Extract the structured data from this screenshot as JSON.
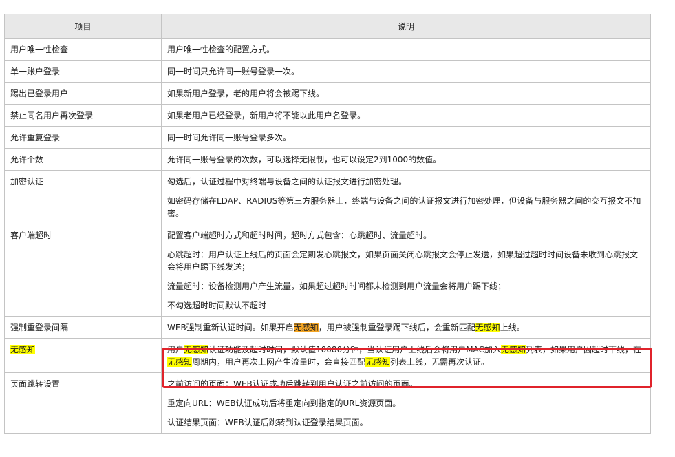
{
  "header": {
    "col_item": "项目",
    "col_desc": "说明"
  },
  "rows": [
    {
      "item": "用户唯一性检查",
      "desc": [
        "用户唯一性检查的配置方式。"
      ]
    },
    {
      "item": "单一账户登录",
      "desc": [
        "同一时间只允许同一账号登录一次。"
      ]
    },
    {
      "item": "踢出已登录用户",
      "desc": [
        "如果新用户登录，老的用户将会被踢下线。"
      ]
    },
    {
      "item": "禁止同名用户再次登录",
      "desc": [
        "如果老用户已经登录，新用户将不能以此用户名登录。"
      ]
    },
    {
      "item": "允许重复登录",
      "desc": [
        "同一时间允许同一账号登录多次。"
      ]
    },
    {
      "item": "允许个数",
      "desc": [
        "允许同一账号登录的次数，可以选择无限制，也可以设定2到1000的数值。"
      ]
    },
    {
      "item": "加密认证",
      "desc": [
        "勾选后，认证过程中对终端与设备之间的认证报文进行加密处理。",
        "如密码存储在LDAP、RADIUS等第三方服务器上，终端与设备之间的认证报文进行加密处理，但设备与服务器之间的交互报文不加密。"
      ]
    },
    {
      "item": "客户端超时",
      "desc": [
        "配置客户端超时方式和超时时间，超时方式包含：心跳超时、流量超时。",
        "心跳超时：用户认证上线后的页面会定期发心跳报文，如果页面关闭心跳报文会停止发送，如果超过超时时间设备未收到心跳报文会将用户踢下线发送；",
        "流量超时：设备检测用户产生流量，如果超过超时时间都未检测到用户流量会将用户踢下线；",
        "不勾选超时时间默认不超时"
      ]
    },
    {
      "item": "强制重登录间隔",
      "desc_parts": [
        "WEB强制重新认证时间。如果开启",
        "无感知",
        "，用户被强制重登录踢下线后，会重新匹配",
        "无感知",
        "上线。"
      ]
    },
    {
      "item": "无感知",
      "desc_parts": [
        "用户",
        "无感知",
        "认证功能及超时时间，默认值10080分钟，当认证用户上线后会将用户MAC加入",
        "无感知",
        "列表，如果用户因超时下线，在",
        "无感知",
        "周期内，用户再次上网产生流量时，会直接匹配",
        "无感知",
        "列表上线，无需再次认证。"
      ]
    },
    {
      "item": "页面跳转设置",
      "desc": [
        "之前访问的页面：WEB认证成功后跳转到用户认证之前访问的页面。",
        "重定向URL：WEB认证成功后将重定向到指定的URL资源页面。",
        "认证结果页面：WEB认证后跳转到认证登录结果页面。"
      ]
    }
  ],
  "colors": {
    "highlight_yellow": "#ffff00",
    "highlight_orange": "#f5a623",
    "callout_border": "#e0232b"
  }
}
